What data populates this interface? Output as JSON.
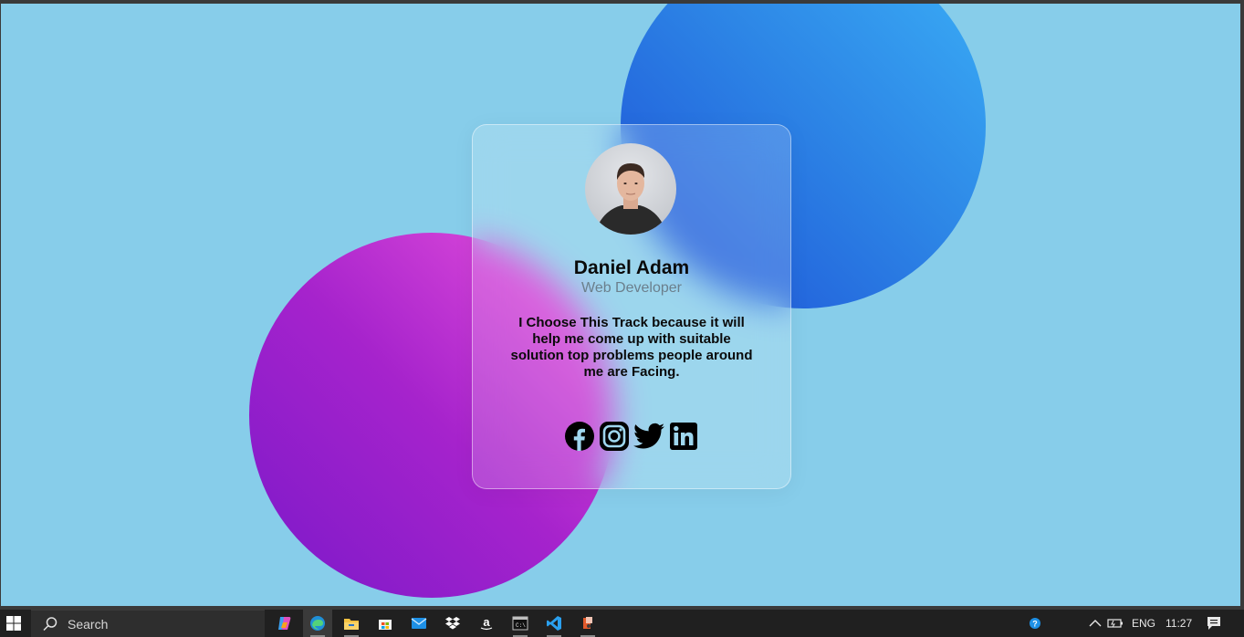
{
  "profile": {
    "name": "Daniel Adam",
    "role": "Web Developer",
    "bio": "I Choose This Track because it will help me come up with suitable solution top problems people around me are Facing."
  },
  "socials": [
    {
      "icon": "facebook-icon"
    },
    {
      "icon": "instagram-icon"
    },
    {
      "icon": "twitter-icon"
    },
    {
      "icon": "linkedin-icon"
    }
  ],
  "colors": {
    "background": "#87cdea",
    "blue_circle": "#2d86e6",
    "purple_circle": "#a623cc",
    "taskbar": "#202020"
  },
  "taskbar": {
    "search_placeholder": "Search",
    "language": "ENG",
    "time": "11:27",
    "apps": [
      "copilot-icon",
      "edge-icon",
      "file-explorer-icon",
      "store-icon",
      "mail-icon",
      "dropbox-icon",
      "amazon-icon",
      "terminal-icon",
      "vscode-icon",
      "git-icon"
    ]
  }
}
